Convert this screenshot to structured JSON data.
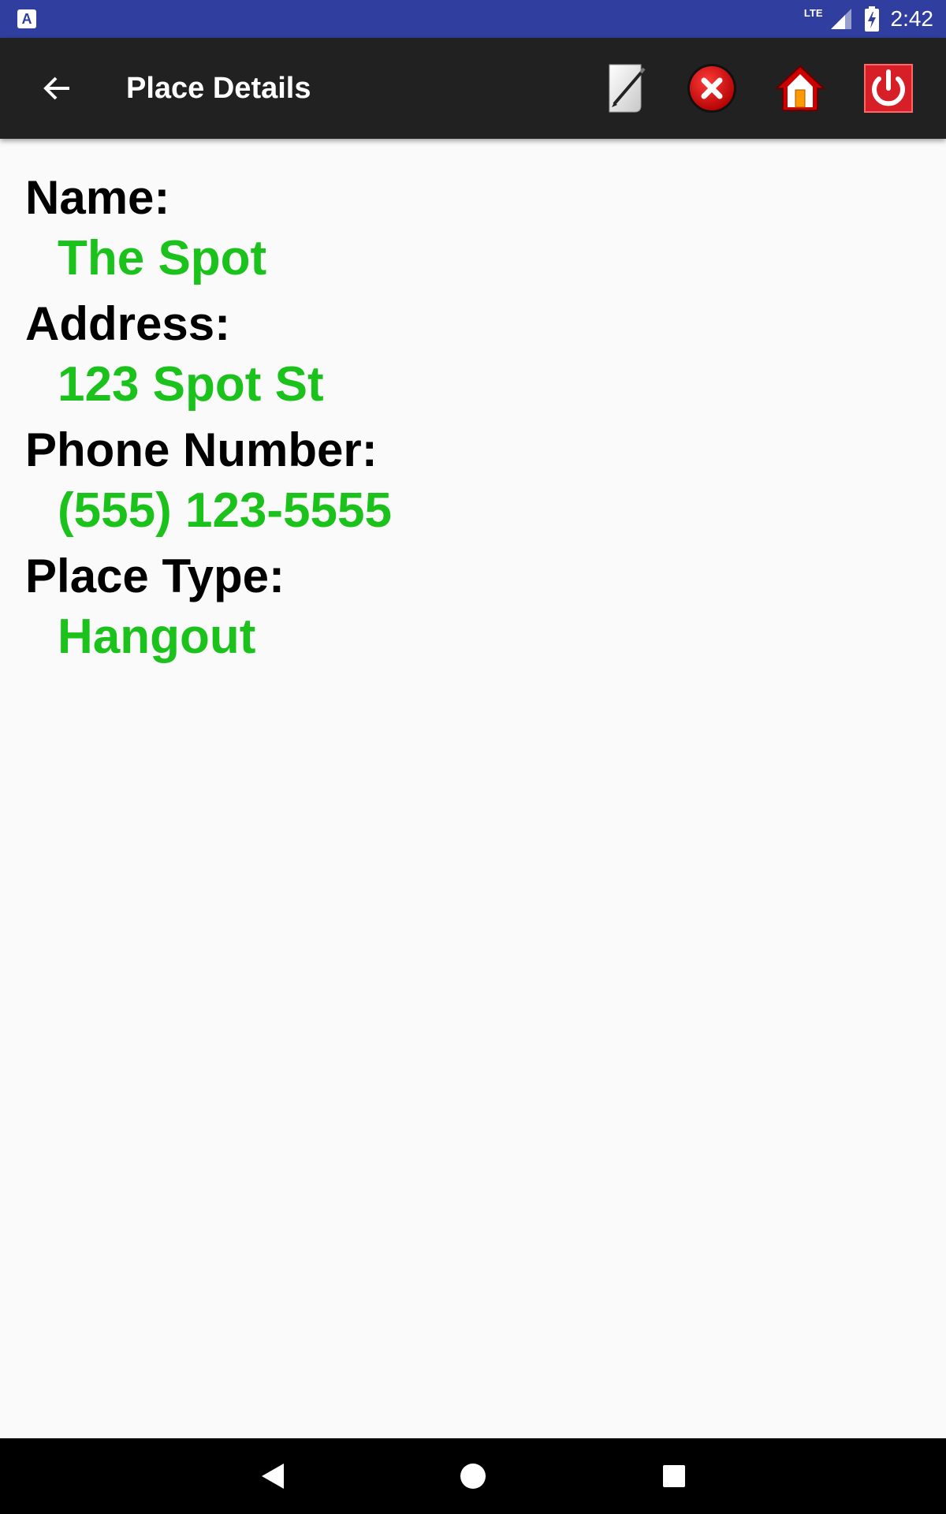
{
  "status_bar": {
    "notification_icon_label": "A",
    "network_label": "LTE",
    "time": "2:42"
  },
  "app_bar": {
    "title": "Place Details",
    "actions": [
      "edit-icon",
      "delete-icon",
      "home-icon",
      "power-icon"
    ]
  },
  "details": {
    "name_label": "Name:",
    "name_value": "The Spot",
    "address_label": "Address:",
    "address_value": "123 Spot St",
    "phone_label": "Phone Number:",
    "phone_value": "(555) 123-5555",
    "type_label": "Place Type:",
    "type_value": "Hangout"
  },
  "colors": {
    "status_bar": "#303f9f",
    "app_bar": "#212121",
    "value_text": "#1cc21c",
    "label_text": "#000000"
  }
}
